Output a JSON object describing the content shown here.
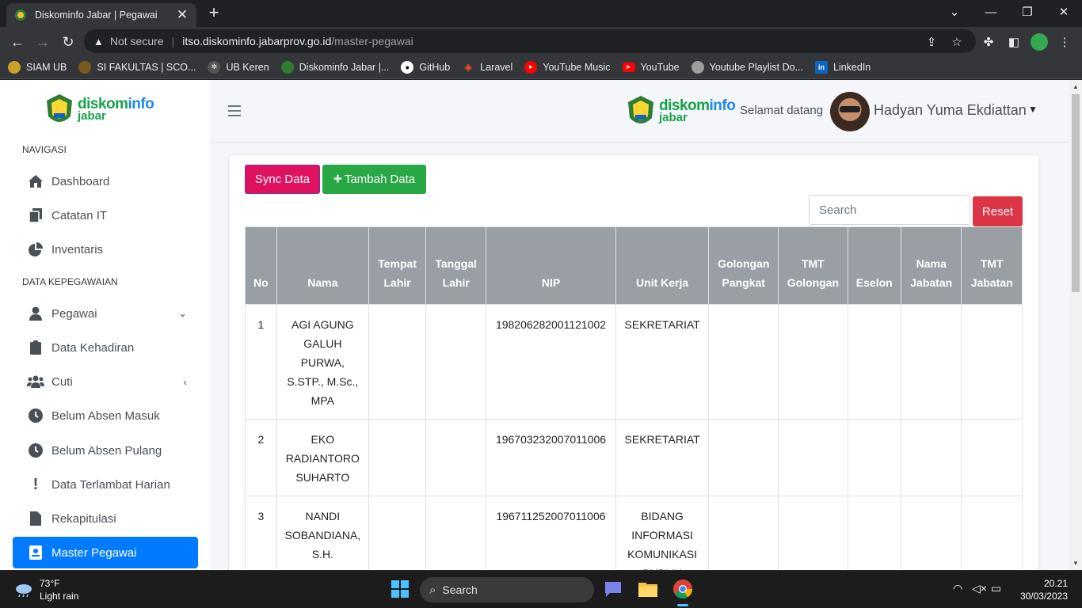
{
  "browser": {
    "tab_title": "Diskominfo Jabar | Pegawai",
    "not_secure": "Not secure",
    "url_host": "itso.diskominfo.jabarprov.go.id",
    "url_path": "/master-pegawai",
    "bookmarks": [
      "SIAM UB",
      "SI FAKULTAS | SCO...",
      "UB Keren",
      "Diskominfo Jabar |...",
      "GitHub",
      "Laravel",
      "YouTube Music",
      "YouTube",
      "Youtube Playlist Do...",
      "LinkedIn"
    ]
  },
  "brand": {
    "part1": "diskom",
    "part2": "info",
    "part3": "jabar"
  },
  "header": {
    "welcome": "Selamat datang",
    "username": "Hadyan Yuma Ekdiattan"
  },
  "sidebar": {
    "section_nav": "NAVIGASI",
    "section_kepegawaian": "DATA KEPEGAWAIAN",
    "items": [
      {
        "label": "Dashboard",
        "icon": "home-icon"
      },
      {
        "label": "Catatan IT",
        "icon": "copy-icon"
      },
      {
        "label": "Inventaris",
        "icon": "pie-chart-icon"
      },
      {
        "label": "Pegawai",
        "icon": "user-icon"
      },
      {
        "label": "Data Kehadiran",
        "icon": "clipboard-icon"
      },
      {
        "label": "Cuti",
        "icon": "users-icon"
      },
      {
        "label": "Belum Absen Masuk",
        "icon": "clock-icon"
      },
      {
        "label": "Belum Absen Pulang",
        "icon": "clock-icon"
      },
      {
        "label": "Data Terlambat Harian",
        "icon": "exclamation-icon"
      },
      {
        "label": "Rekapitulasi",
        "icon": "file-icon"
      },
      {
        "label": "Master Pegawai",
        "icon": "id-card-icon"
      }
    ]
  },
  "toolbar": {
    "sync_label": "Sync Data",
    "add_label": "Tambah Data",
    "search_placeholder": "Search",
    "reset_label": "Reset"
  },
  "table": {
    "columns": [
      "No",
      "Nama",
      "Tempat Lahir",
      "Tanggal Lahir",
      "NIP",
      "Unit Kerja",
      "Golongan Pangkat",
      "TMT Golongan",
      "Eselon",
      "Nama Jabatan",
      "TMT Jabatan"
    ],
    "rows": [
      [
        "1",
        "AGI AGUNG GALUH PURWA, S.STP., M.Sc., MPA",
        "",
        "",
        "198206282001121002",
        "SEKRETARIAT",
        "",
        "",
        "",
        "",
        ""
      ],
      [
        "2",
        "EKO RADIANTORO SUHARTO",
        "",
        "",
        "196703232007011006",
        "SEKRETARIAT",
        "",
        "",
        "",
        "",
        ""
      ],
      [
        "3",
        "NANDI SOBANDIANA, S.H.",
        "",
        "",
        "196711252007011006",
        "BIDANG INFORMASI KOMUNIKASI PUBLIK",
        "",
        "",
        "",
        "",
        ""
      ]
    ]
  },
  "taskbar": {
    "temp": "73°F",
    "weather": "Light rain",
    "search": "Search",
    "time": "20.21",
    "date": "30/03/2023"
  },
  "colors": {
    "primary": "#007bff",
    "sync": "#e0115f",
    "add": "#28a745",
    "reset": "#dc3545",
    "table_header": "#9a9fa5"
  }
}
